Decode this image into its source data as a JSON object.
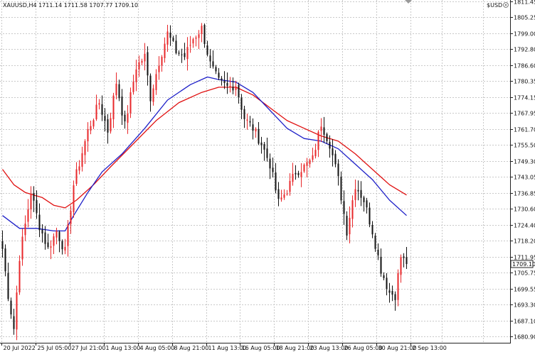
{
  "header": {
    "symbol_info": "XAUUSD,H4  1711.14 1711.58 1707.77 1709.10",
    "currency_label": "$USD",
    "currency_icon": "gear-icon"
  },
  "price_tag": "1709.10",
  "chart_data": {
    "type": "candlestick",
    "ylim": [
      1678.0,
      1815.0
    ],
    "y_ticks": [
      "1811.45",
      "1805.25",
      "1799.00",
      "1792.80",
      "1786.60",
      "1780.35",
      "1774.15",
      "1767.95",
      "1761.70",
      "1755.50",
      "1749.30",
      "1743.05",
      "1736.85",
      "1730.60",
      "1724.40",
      "1718.20",
      "1711.95",
      "1705.75",
      "1699.55",
      "1693.30",
      "1687.10",
      "1680.90"
    ],
    "x_ticks": [
      "20 Jul 2022",
      "25 Jul 05:00",
      "27 Jul 21:00",
      "1 Aug 13:00",
      "4 Aug 05:00",
      "8 Aug 21:00",
      "11 Aug 13:00",
      "16 Aug 05:00",
      "18 Aug 21:00",
      "23 Aug 13:00",
      "26 Aug 05:00",
      "30 Aug 21:00",
      "2 Sep 13:00"
    ],
    "last_price": 1709.1,
    "colors": {
      "up": "#e8272a",
      "down": "#111111",
      "ma_fast": "#1d1fc8",
      "ma_slow": "#e01010",
      "grid": "#c9c9c9"
    },
    "key_points": [
      {
        "t": 0,
        "p": 1715
      },
      {
        "t": 2,
        "p": 1697
      },
      {
        "t": 4,
        "p": 1684
      },
      {
        "t": 6,
        "p": 1712
      },
      {
        "t": 10,
        "p": 1737
      },
      {
        "t": 13,
        "p": 1724
      },
      {
        "t": 16,
        "p": 1715
      },
      {
        "t": 19,
        "p": 1722
      },
      {
        "t": 22,
        "p": 1714
      },
      {
        "t": 25,
        "p": 1740
      },
      {
        "t": 30,
        "p": 1761
      },
      {
        "t": 34,
        "p": 1772
      },
      {
        "t": 37,
        "p": 1761
      },
      {
        "t": 40,
        "p": 1780
      },
      {
        "t": 43,
        "p": 1763
      },
      {
        "t": 47,
        "p": 1786
      },
      {
        "t": 50,
        "p": 1790
      },
      {
        "t": 52,
        "p": 1774
      },
      {
        "t": 55,
        "p": 1788
      },
      {
        "t": 58,
        "p": 1799
      },
      {
        "t": 61,
        "p": 1792
      },
      {
        "t": 64,
        "p": 1790
      },
      {
        "t": 67,
        "p": 1797
      },
      {
        "t": 70,
        "p": 1801
      },
      {
        "t": 73,
        "p": 1787
      },
      {
        "t": 76,
        "p": 1780
      },
      {
        "t": 79,
        "p": 1778
      },
      {
        "t": 82,
        "p": 1779
      },
      {
        "t": 85,
        "p": 1766
      },
      {
        "t": 88,
        "p": 1762
      },
      {
        "t": 91,
        "p": 1756
      },
      {
        "t": 94,
        "p": 1748
      },
      {
        "t": 97,
        "p": 1733
      },
      {
        "t": 100,
        "p": 1738
      },
      {
        "t": 103,
        "p": 1745
      },
      {
        "t": 106,
        "p": 1747
      },
      {
        "t": 109,
        "p": 1750
      },
      {
        "t": 112,
        "p": 1764
      },
      {
        "t": 115,
        "p": 1756
      },
      {
        "t": 118,
        "p": 1742
      },
      {
        "t": 121,
        "p": 1722
      },
      {
        "t": 124,
        "p": 1740
      },
      {
        "t": 127,
        "p": 1734
      },
      {
        "t": 130,
        "p": 1722
      },
      {
        "t": 133,
        "p": 1707
      },
      {
        "t": 136,
        "p": 1698
      },
      {
        "t": 138,
        "p": 1697
      },
      {
        "t": 140,
        "p": 1712
      },
      {
        "t": 142,
        "p": 1709
      }
    ],
    "ma_fast": [
      {
        "t": 0,
        "p": 1728
      },
      {
        "t": 6,
        "p": 1723
      },
      {
        "t": 12,
        "p": 1723
      },
      {
        "t": 18,
        "p": 1722
      },
      {
        "t": 22,
        "p": 1722
      },
      {
        "t": 25,
        "p": 1728
      },
      {
        "t": 30,
        "p": 1737
      },
      {
        "t": 35,
        "p": 1745
      },
      {
        "t": 42,
        "p": 1752
      },
      {
        "t": 50,
        "p": 1762
      },
      {
        "t": 58,
        "p": 1773
      },
      {
        "t": 66,
        "p": 1779
      },
      {
        "t": 72,
        "p": 1782
      },
      {
        "t": 76,
        "p": 1781
      },
      {
        "t": 82,
        "p": 1780
      },
      {
        "t": 88,
        "p": 1776
      },
      {
        "t": 94,
        "p": 1769
      },
      {
        "t": 100,
        "p": 1762
      },
      {
        "t": 106,
        "p": 1758
      },
      {
        "t": 112,
        "p": 1757
      },
      {
        "t": 118,
        "p": 1754
      },
      {
        "t": 124,
        "p": 1748
      },
      {
        "t": 130,
        "p": 1742
      },
      {
        "t": 136,
        "p": 1734
      },
      {
        "t": 142,
        "p": 1728
      }
    ],
    "ma_slow": [
      {
        "t": 0,
        "p": 1746
      },
      {
        "t": 4,
        "p": 1740
      },
      {
        "t": 8,
        "p": 1737
      },
      {
        "t": 14,
        "p": 1735
      },
      {
        "t": 18,
        "p": 1732
      },
      {
        "t": 22,
        "p": 1731
      },
      {
        "t": 26,
        "p": 1734
      },
      {
        "t": 32,
        "p": 1740
      },
      {
        "t": 38,
        "p": 1747
      },
      {
        "t": 46,
        "p": 1756
      },
      {
        "t": 54,
        "p": 1765
      },
      {
        "t": 62,
        "p": 1772
      },
      {
        "t": 70,
        "p": 1776
      },
      {
        "t": 76,
        "p": 1778
      },
      {
        "t": 82,
        "p": 1778
      },
      {
        "t": 88,
        "p": 1775
      },
      {
        "t": 94,
        "p": 1770
      },
      {
        "t": 100,
        "p": 1765
      },
      {
        "t": 106,
        "p": 1762
      },
      {
        "t": 112,
        "p": 1759
      },
      {
        "t": 118,
        "p": 1757
      },
      {
        "t": 124,
        "p": 1752
      },
      {
        "t": 130,
        "p": 1746
      },
      {
        "t": 136,
        "p": 1740
      },
      {
        "t": 142,
        "p": 1736
      }
    ]
  }
}
